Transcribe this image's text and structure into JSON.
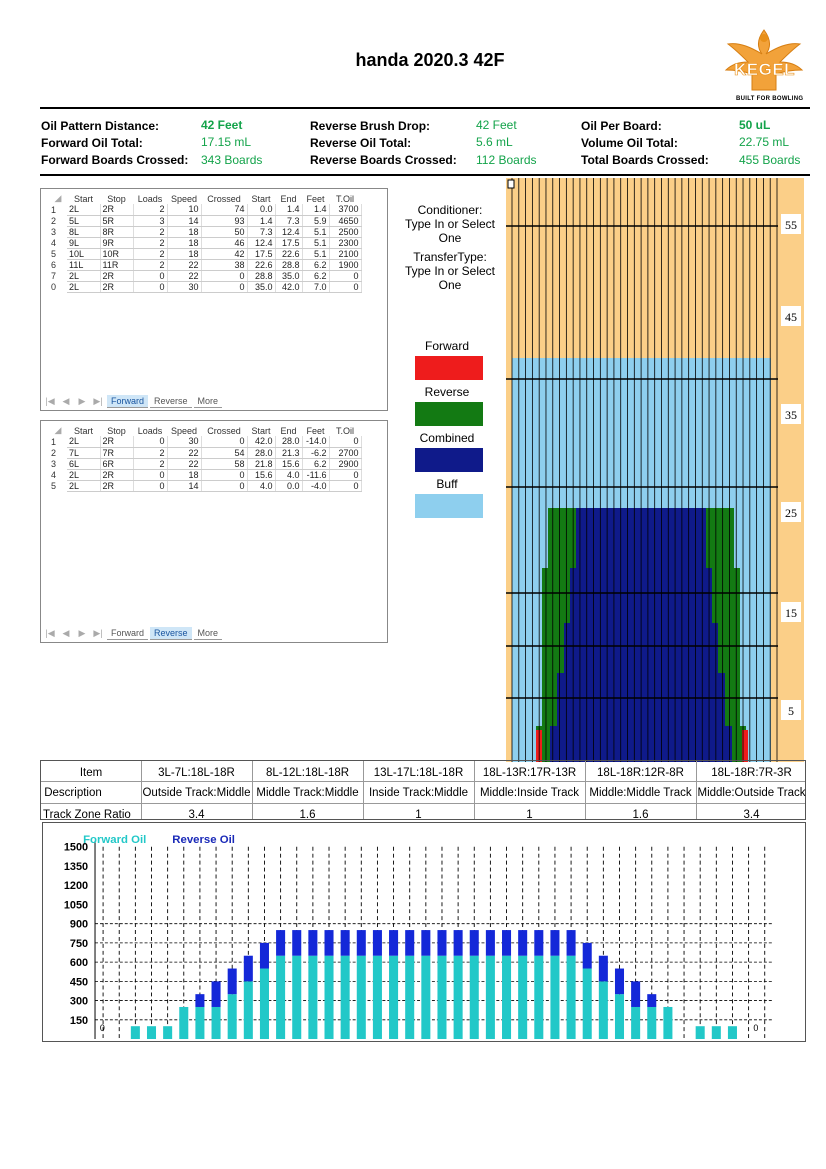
{
  "header": {
    "title": "handa 2020.3 42F",
    "logo_text": "KEGEL",
    "logo_tagline": "BUILT FOR BOWLING"
  },
  "stats": {
    "oil_pattern_distance_label": "Oil Pattern Distance:",
    "oil_pattern_distance_value": "42 Feet",
    "forward_oil_total_label": "Forward Oil Total:",
    "forward_oil_total_value": "17.15 mL",
    "forward_boards_crossed_label": "Forward Boards Crossed:",
    "forward_boards_crossed_value": "343 Boards",
    "reverse_brush_drop_label": "Reverse Brush Drop:",
    "reverse_brush_drop_value": "42 Feet",
    "reverse_oil_total_label": "Reverse Oil Total:",
    "reverse_oil_total_value": "5.6 mL",
    "reverse_boards_crossed_label": "Reverse Boards Crossed:",
    "reverse_boards_crossed_value": "112 Boards",
    "oil_per_board_label": "Oil Per Board:",
    "oil_per_board_value": "50 uL",
    "volume_oil_total_label": "Volume Oil Total:",
    "volume_oil_total_value": "22.75 mL",
    "total_boards_crossed_label": "Total Boards Crossed:",
    "total_boards_crossed_value": "455 Boards"
  },
  "forward_grid": {
    "columns": [
      "Start",
      "Stop",
      "Loads",
      "Speed",
      "Crossed",
      "Start",
      "End",
      "Feet",
      "T.Oil"
    ],
    "rows": [
      [
        "1",
        "2L",
        "2R",
        "2",
        "10",
        "74",
        "0.0",
        "1.4",
        "1.4",
        "3700"
      ],
      [
        "2",
        "5L",
        "5R",
        "3",
        "14",
        "93",
        "1.4",
        "7.3",
        "5.9",
        "4650"
      ],
      [
        "3",
        "8L",
        "8R",
        "2",
        "18",
        "50",
        "7.3",
        "12.4",
        "5.1",
        "2500"
      ],
      [
        "4",
        "9L",
        "9R",
        "2",
        "18",
        "46",
        "12.4",
        "17.5",
        "5.1",
        "2300"
      ],
      [
        "5",
        "10L",
        "10R",
        "2",
        "18",
        "42",
        "17.5",
        "22.6",
        "5.1",
        "2100"
      ],
      [
        "6",
        "11L",
        "11R",
        "2",
        "22",
        "38",
        "22.6",
        "28.8",
        "6.2",
        "1900"
      ],
      [
        "7",
        "2L",
        "2R",
        "0",
        "22",
        "0",
        "28.8",
        "35.0",
        "6.2",
        "0"
      ],
      [
        "0",
        "2L",
        "2R",
        "0",
        "30",
        "0",
        "35.0",
        "42.0",
        "7.0",
        "0"
      ]
    ],
    "tabs": [
      "Forward",
      "Reverse",
      "More"
    ],
    "active_tab": 0
  },
  "reverse_grid": {
    "columns": [
      "Start",
      "Stop",
      "Loads",
      "Speed",
      "Crossed",
      "Start",
      "End",
      "Feet",
      "T.Oil"
    ],
    "rows": [
      [
        "1",
        "2L",
        "2R",
        "0",
        "30",
        "0",
        "42.0",
        "28.0",
        "-14.0",
        "0"
      ],
      [
        "2",
        "7L",
        "7R",
        "2",
        "22",
        "54",
        "28.0",
        "21.3",
        "-6.2",
        "2700"
      ],
      [
        "3",
        "6L",
        "6R",
        "2",
        "22",
        "58",
        "21.8",
        "15.6",
        "6.2",
        "2900"
      ],
      [
        "4",
        "2L",
        "2R",
        "0",
        "18",
        "0",
        "15.6",
        "4.0",
        "-11.6",
        "0"
      ],
      [
        "5",
        "2L",
        "2R",
        "0",
        "14",
        "0",
        "4.0",
        "0.0",
        "-4.0",
        "0"
      ]
    ],
    "tabs": [
      "Forward",
      "Reverse",
      "More"
    ],
    "active_tab": 1
  },
  "side_panel": {
    "conditioner_label": "Conditioner:",
    "conditioner_value": "Type In or Select One",
    "transfer_label": "TransferType:",
    "transfer_value": "Type In or Select One"
  },
  "legend": {
    "forward": {
      "label": "Forward",
      "color": "#ee1c1c"
    },
    "reverse": {
      "label": "Reverse",
      "color": "#137a13"
    },
    "combined": {
      "label": "Combined",
      "color": "#0f1a8a"
    },
    "buff": {
      "label": "Buff",
      "color": "#8ecfee"
    }
  },
  "lane_graph": {
    "distance_labels": [
      "55",
      "45",
      "35",
      "25",
      "15",
      "5"
    ],
    "colors": {
      "lane": "#fbcf88",
      "buff": "#8ecfee",
      "reverse": "#137a13",
      "combined": "#0f1a8a",
      "forward": "#ee1c1c"
    }
  },
  "track_zone": {
    "item_label": "Item",
    "description_label": "Description",
    "ratio_label": "Track Zone Ratio",
    "columns": [
      {
        "item": "3L-7L:18L-18R",
        "description": "Outside Track:Middle",
        "ratio": "3.4"
      },
      {
        "item": "8L-12L:18L-18R",
        "description": "Middle Track:Middle",
        "ratio": "1.6"
      },
      {
        "item": "13L-17L:18L-18R",
        "description": "Inside Track:Middle",
        "ratio": "1"
      },
      {
        "item": "18L-13R:17R-13R",
        "description": "Middle:Inside Track",
        "ratio": "1"
      },
      {
        "item": "18L-18R:12R-8R",
        "description": "Middle:Middle Track",
        "ratio": "1.6"
      },
      {
        "item": "18L-18R:7R-3R",
        "description": "Middle:Outside Track",
        "ratio": "3.4"
      }
    ]
  },
  "chart_data": {
    "type": "bar",
    "stacked": true,
    "series": [
      {
        "name": "Forward Oil",
        "color": "#22c8c8",
        "values": [
          0,
          0,
          100,
          100,
          100,
          250,
          250,
          250,
          350,
          450,
          550,
          650,
          650,
          650,
          650,
          650,
          650,
          650,
          650,
          650,
          650,
          650,
          650,
          650,
          650,
          650,
          650,
          650,
          650,
          650,
          550,
          450,
          350,
          250,
          250,
          250,
          0,
          100,
          100,
          100,
          0,
          0
        ]
      },
      {
        "name": "Reverse Oil",
        "color": "#1428d8",
        "values": [
          0,
          0,
          0,
          0,
          0,
          0,
          100,
          200,
          200,
          200,
          200,
          200,
          200,
          200,
          200,
          200,
          200,
          200,
          200,
          200,
          200,
          200,
          200,
          200,
          200,
          200,
          200,
          200,
          200,
          200,
          200,
          200,
          200,
          200,
          100,
          0,
          0,
          0,
          0,
          0,
          0,
          0
        ]
      }
    ],
    "edge_labels": [
      "0",
      "0"
    ],
    "y_ticks": [
      "1500",
      "1350",
      "1200",
      "1050",
      "900",
      "750",
      "600",
      "450",
      "300",
      "150"
    ],
    "ylim": [
      0,
      1500
    ]
  }
}
